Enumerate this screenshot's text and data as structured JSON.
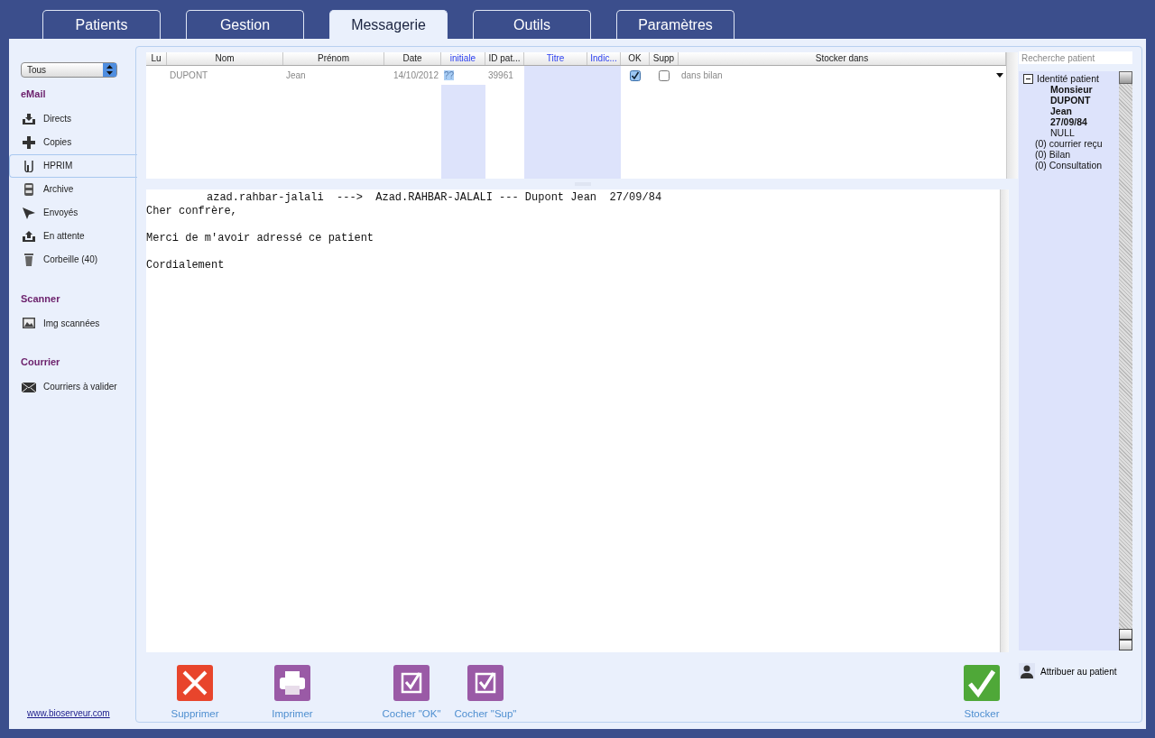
{
  "tabs": [
    {
      "label": "Patients",
      "selected": false
    },
    {
      "label": "Gestion",
      "selected": false
    },
    {
      "label": "Messagerie",
      "selected": true
    },
    {
      "label": "Outils",
      "selected": false
    },
    {
      "label": "Paramètres",
      "selected": false
    }
  ],
  "sidebar": {
    "filter": {
      "value": "Tous"
    },
    "sections": [
      {
        "title": "eMail",
        "items": [
          {
            "label": "Directs",
            "selected": false
          },
          {
            "label": "Copies",
            "selected": false
          },
          {
            "label": "HPRIM",
            "selected": true
          },
          {
            "label": "Archive",
            "selected": false
          },
          {
            "label": "Envoyés",
            "selected": false
          },
          {
            "label": "En attente",
            "selected": false
          },
          {
            "label": "Corbeille (40)",
            "selected": false
          }
        ]
      },
      {
        "title": "Scanner",
        "items": [
          {
            "label": "Img scannées",
            "selected": false
          }
        ]
      },
      {
        "title": "Courrier",
        "items": [
          {
            "label": "Courriers à valider",
            "selected": false
          }
        ]
      }
    ],
    "footer_link": "www.bioserveur.com"
  },
  "table": {
    "columns": [
      {
        "label": "Lu",
        "highlight": false
      },
      {
        "label": "Nom",
        "highlight": false
      },
      {
        "label": "Prénom",
        "highlight": false
      },
      {
        "label": "Date",
        "highlight": false
      },
      {
        "label": "initiale",
        "highlight": true
      },
      {
        "label": "ID pat...",
        "highlight": false
      },
      {
        "label": "Titre",
        "highlight": true
      },
      {
        "label": "Indic...",
        "highlight": true
      },
      {
        "label": "OK",
        "highlight": false
      },
      {
        "label": "Supp",
        "highlight": false
      },
      {
        "label": "Stocker dans",
        "highlight": false
      }
    ],
    "rows": [
      {
        "nom": "DUPONT",
        "prenom": "Jean",
        "date": "14/10/2012",
        "initiale": "??",
        "id": "39961",
        "ok": true,
        "supp": false,
        "stocker": "dans bilan"
      }
    ]
  },
  "message": {
    "lines": [
      {
        "kind": "header",
        "text": "azad.rahbar-jalali  --->  Azad.RAHBAR-JALALI --- Dupont Jean  27/09/84"
      },
      {
        "kind": "line",
        "text": "Cher confrère,"
      },
      {
        "kind": "paragraph",
        "text": "Merci de m'avoir adressé ce patient"
      },
      {
        "kind": "paragraph",
        "text": "Cordialement"
      }
    ]
  },
  "actions": [
    {
      "label": "Supprimer",
      "color": "#e8452c"
    },
    {
      "label": "Imprimer",
      "color": "#9a5aa6"
    },
    {
      "label": "Cocher \"OK\"",
      "color": "#9a5aa6"
    },
    {
      "label": "Cocher \"Sup\"",
      "color": "#9a5aa6"
    },
    {
      "label": "Stocker",
      "color": "#4fa838"
    }
  ],
  "patient_panel": {
    "search": {
      "placeholder": "Recherche patient"
    },
    "tree": [
      {
        "label": "Identité patient",
        "expanded": true,
        "children": [
          {
            "label": "Monsieur",
            "kind": "bold"
          },
          {
            "label": "DUPONT",
            "kind": "bold"
          },
          {
            "label": "Jean",
            "kind": "bold"
          },
          {
            "label": "27/09/84",
            "kind": "bold"
          },
          {
            "label": "NULL",
            "kind": "plain"
          }
        ]
      },
      {
        "label": "(0) courrier reçu"
      },
      {
        "label": "(0) Bilan"
      },
      {
        "label": "(0) Consultation"
      }
    ],
    "assign_button": "Attribuer au patient"
  }
}
